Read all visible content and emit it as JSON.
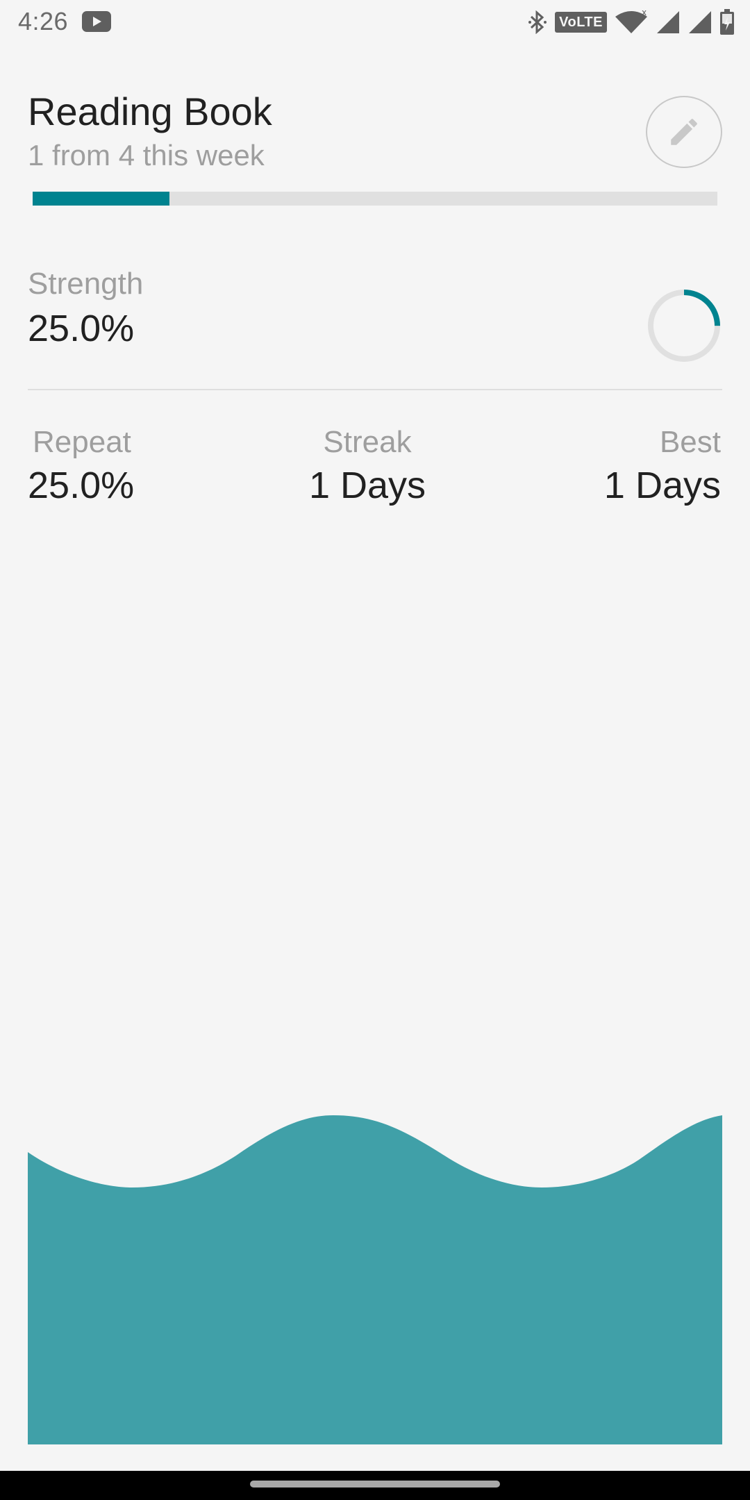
{
  "status_bar": {
    "time": "4:26",
    "volte": "VoLTE",
    "icons": [
      "youtube-icon",
      "bluetooth-icon",
      "wifi-icon",
      "signal-icon",
      "battery-icon"
    ]
  },
  "habit": {
    "title": "Reading Book",
    "subtitle": "1 from 4 this week",
    "week_progress_fraction": 0.2
  },
  "strength": {
    "label": "Strength",
    "value": "25.0%",
    "ring_fraction": 0.25
  },
  "stats": {
    "repeat": {
      "label": "Repeat",
      "value": "25.0%"
    },
    "streak": {
      "label": "Streak",
      "value": "1 Days"
    },
    "best": {
      "label": "Best",
      "value": "1 Days"
    }
  },
  "colors": {
    "accent": "#00838f",
    "wave": "#40a0a8",
    "track": "#e0e0e0",
    "background": "#f5f5f5"
  }
}
